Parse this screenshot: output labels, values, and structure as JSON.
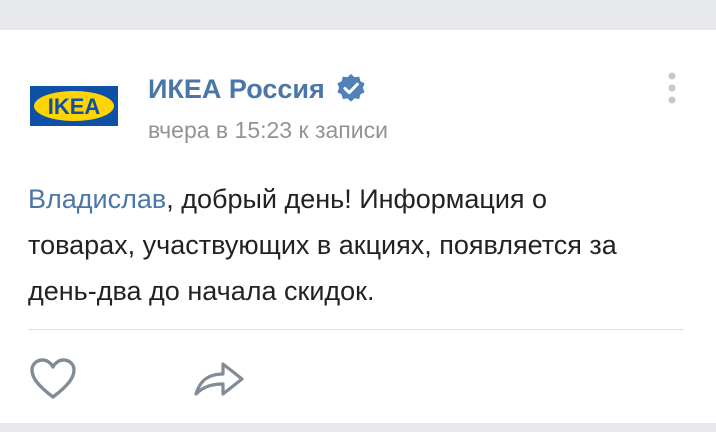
{
  "post": {
    "author": "ИКЕА Россия",
    "timestamp": "вчера в 15:23 к записи",
    "logo_text": "IKEA",
    "mention": "Владислав",
    "text_part1": ", добрый день! Информация о",
    "text_part2": "товарах, участвующих в акциях, появляется за",
    "text_part3": "день-два до начала скидок."
  },
  "icons": {
    "verified": "verified-check-icon",
    "menu": "more-vertical-icon",
    "like": "heart-icon",
    "share": "share-arrow-icon"
  },
  "colors": {
    "link_blue": "#4a76a8",
    "ikea_blue": "#0d51a7",
    "ikea_yellow": "#ffd400",
    "muted_gray": "#939393"
  }
}
